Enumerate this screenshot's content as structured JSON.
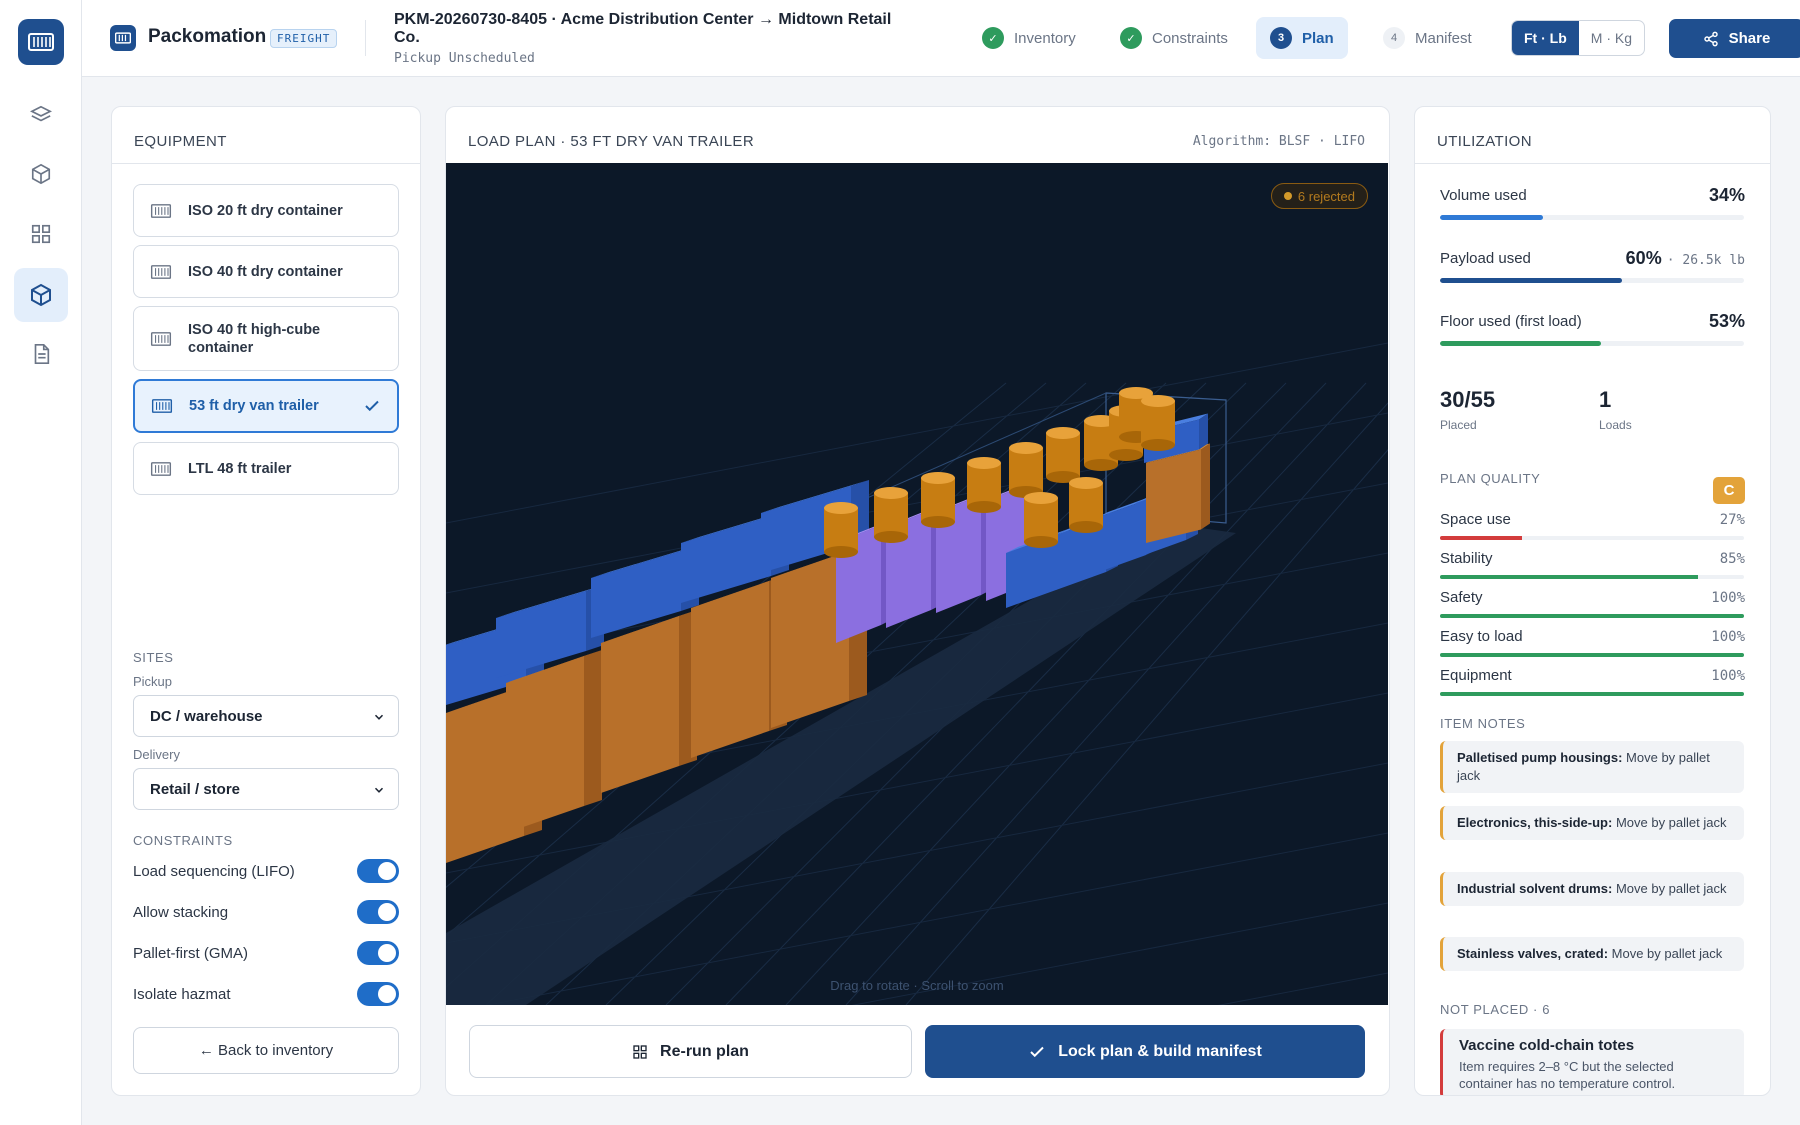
{
  "header": {
    "brand": "Packomation",
    "badge": "FREIGHT",
    "job_title": "PKM-20260730-8405 · Acme Distribution Center → Midtown Retail Co.",
    "job_sub": "Pickup Unscheduled",
    "steps": [
      {
        "label": "Inventory",
        "state": "done",
        "marker": "✓"
      },
      {
        "label": "Constraints",
        "state": "done",
        "marker": "✓"
      },
      {
        "label": "Plan",
        "state": "active",
        "marker": "3"
      },
      {
        "label": "Manifest",
        "state": "todo",
        "marker": "4"
      }
    ],
    "units": [
      "Ft · Lb",
      "M · Kg"
    ],
    "share": "Share"
  },
  "equipment": {
    "title": "EQUIPMENT",
    "items": [
      {
        "label": "ISO 20 ft dry container",
        "selected": false
      },
      {
        "label": "ISO 40 ft dry container",
        "selected": false
      },
      {
        "label": "ISO 40 ft high-cube container",
        "selected": false
      },
      {
        "label": "53 ft dry van trailer",
        "selected": true
      },
      {
        "label": "LTL 48 ft trailer",
        "selected": false
      }
    ],
    "sites_label": "SITES",
    "pickup_label": "Pickup",
    "pickup_value": "DC / warehouse",
    "delivery_label": "Delivery",
    "delivery_value": "Retail / store",
    "constraints_label": "CONSTRAINTS",
    "constraints": [
      {
        "label": "Load sequencing (LIFO)",
        "on": true
      },
      {
        "label": "Allow stacking",
        "on": true
      },
      {
        "label": "Pallet-first (GMA)",
        "on": true
      },
      {
        "label": "Isolate hazmat",
        "on": true
      }
    ],
    "back": "← Back to inventory"
  },
  "plan": {
    "title": "LOAD PLAN · 53 FT DRY VAN TRAILER",
    "algorithm": "Algorithm: BLSF · LIFO",
    "rejected": "6 rejected",
    "hint": "Drag to rotate · Scroll to zoom",
    "rerun": "Re-run plan",
    "lock": "Lock plan & build manifest"
  },
  "utilization": {
    "title": "UTILIZATION",
    "volume_label": "Volume used",
    "volume_value": "34%",
    "volume_pct": 34,
    "payload_label": "Payload used",
    "payload_value": "60%",
    "payload_extra": "· 26.5k lb",
    "payload_pct": 60,
    "floor_label": "Floor used (first load)",
    "floor_value": "53%",
    "floor_pct": 53,
    "placed_value": "30/55",
    "placed_label": "Placed",
    "loads_value": "1",
    "loads_label": "Loads",
    "quality_label": "PLAN QUALITY",
    "grade": "C",
    "quality": [
      {
        "label": "Space use",
        "value": "27%",
        "pct": 27,
        "color": "#d33c3c"
      },
      {
        "label": "Stability",
        "value": "85%",
        "pct": 85,
        "color": "#2e9b5d"
      },
      {
        "label": "Safety",
        "value": "100%",
        "pct": 100,
        "color": "#2e9b5d"
      },
      {
        "label": "Easy to load",
        "value": "100%",
        "pct": 100,
        "color": "#2e9b5d"
      },
      {
        "label": "Equipment",
        "value": "100%",
        "pct": 100,
        "color": "#2e9b5d"
      }
    ],
    "notes_label": "ITEM NOTES",
    "notes": [
      {
        "item": "Palletised pump housings:",
        "text": "Move by pallet jack"
      },
      {
        "item": "Electronics, this-side-up:",
        "text": "Move by pallet jack"
      },
      {
        "item": "Industrial solvent drums:",
        "text": "Move by pallet jack"
      },
      {
        "item": "Stainless valves, crated:",
        "text": "Move by pallet jack"
      }
    ],
    "not_placed_label": "NOT PLACED · 6",
    "not_placed": [
      {
        "title": "Vaccine cold-chain totes",
        "desc": "Item requires 2–8 °C but the selected container has no temperature control."
      }
    ]
  },
  "colors": {
    "brand": "#1f4f8f",
    "accent": "#2f7ad6",
    "success": "#2e9b5d",
    "warning": "#e3a33a",
    "danger": "#d33c3c"
  }
}
